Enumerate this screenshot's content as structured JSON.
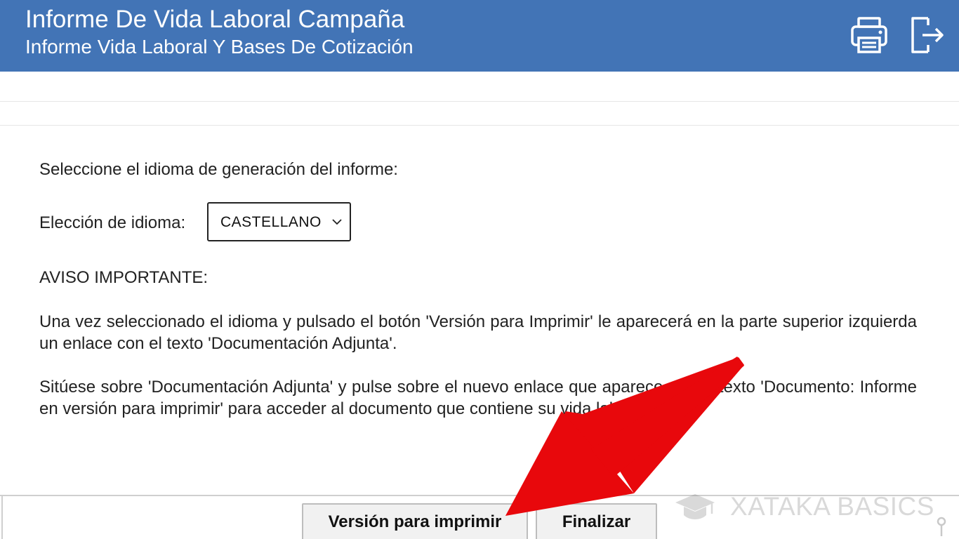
{
  "header": {
    "title": "Informe De Vida Laboral Campaña",
    "subtitle": "Informe Vida Laboral Y Bases De Cotización",
    "print_icon": "printer-icon",
    "logout_icon": "logout-icon",
    "background_color": "#4274b6"
  },
  "main": {
    "select_language_prompt": "Seleccione el idioma de generación del informe:",
    "language_label": "Elección de idioma:",
    "language_selected": "CASTELLANO",
    "notice_heading": "AVISO IMPORTANTE:",
    "notice_paragraph_1": "Una vez seleccionado el idioma y pulsado el botón 'Versión para Imprimir' le aparecerá en la parte superior izquierda un enlace con el texto 'Documentación Adjunta'.",
    "notice_paragraph_2": "Sitúese sobre 'Documentación Adjunta' y pulse sobre el nuevo enlace que aparece con el texto 'Documento: Informe en versión para imprimir' para acceder al documento que contiene su vida laboral."
  },
  "footer": {
    "print_version_button": "Versión para imprimir",
    "finish_button": "Finalizar"
  },
  "watermark": {
    "text": "XATAKA BASICS",
    "icon": "graduation-cap-icon"
  },
  "annotation": {
    "arrow_color": "#e8080c"
  }
}
